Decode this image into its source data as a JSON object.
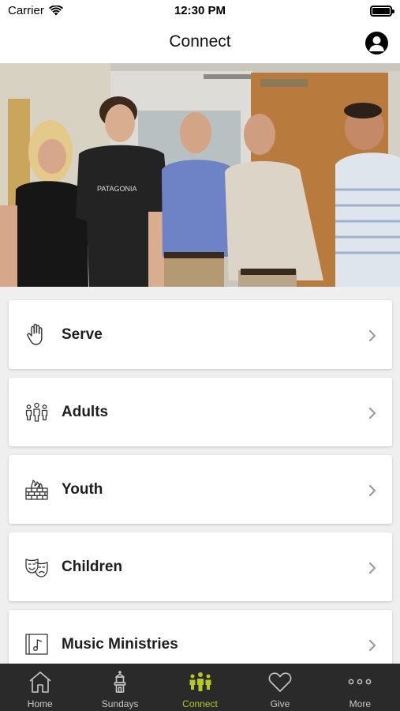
{
  "status_bar": {
    "carrier": "Carrier",
    "time": "12:30 PM"
  },
  "header": {
    "title": "Connect"
  },
  "hero": {
    "image": "group-photo"
  },
  "menu": {
    "items": [
      {
        "label": "Serve",
        "icon": "hand-icon"
      },
      {
        "label": "Adults",
        "icon": "people-icon"
      },
      {
        "label": "Youth",
        "icon": "fire-wall-icon"
      },
      {
        "label": "Children",
        "icon": "theater-masks-icon"
      },
      {
        "label": "Music Ministries",
        "icon": "music-note-icon"
      }
    ]
  },
  "tabs": [
    {
      "label": "Home",
      "icon": "home-icon",
      "active": false
    },
    {
      "label": "Sundays",
      "icon": "tower-icon",
      "active": false
    },
    {
      "label": "Connect",
      "icon": "group-icon",
      "active": true
    },
    {
      "label": "Give",
      "icon": "heart-icon",
      "active": false
    },
    {
      "label": "More",
      "icon": "ellipsis-icon",
      "active": false
    }
  ],
  "colors": {
    "accent": "#b5c921",
    "tabbar_bg": "#2a2a2a",
    "page_bg": "#efefef"
  }
}
